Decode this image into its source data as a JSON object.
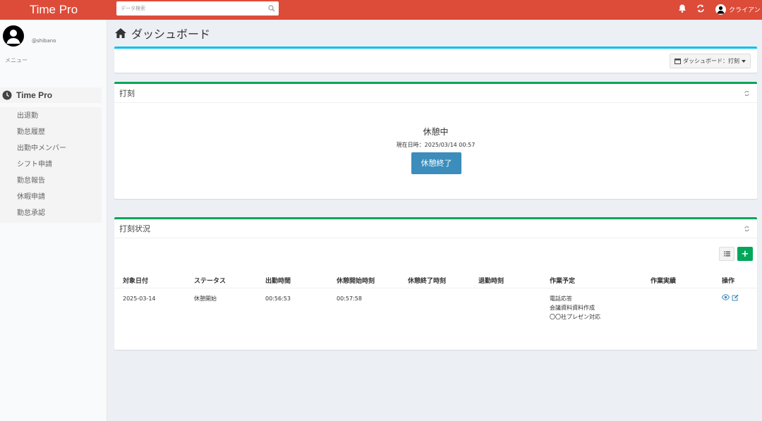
{
  "header": {
    "brand": "Time Pro",
    "search_placeholder": "データ検索",
    "user_label": "クライアント",
    "icons": [
      "search-icon",
      "bell-icon",
      "refresh-icon",
      "user-icon"
    ],
    "color": "#dd4b39"
  },
  "sidebar": {
    "username": "@shibano",
    "menu_label": "メニュー",
    "section_title": "Time Pro",
    "items": [
      "出退勤",
      "勤怠履歴",
      "出勤中メンバー",
      "シフト申請",
      "勤怠報告",
      "休暇申請",
      "勤怠承認"
    ]
  },
  "page": {
    "title": "ダッシュボード",
    "dashboard_select": "ダッシュボード：打刻"
  },
  "punch": {
    "title": "打刻",
    "status": "休憩中",
    "datetime": "現在日時：2025/03/14 00:57",
    "button": "休憩終了",
    "button_color": "#3c8dbc"
  },
  "status_panel": {
    "title": "打刻状況",
    "add_label": "+",
    "columns": [
      "対象日付",
      "ステータス",
      "出勤時間",
      "休憩開始時刻",
      "休憩終了時刻",
      "退勤時刻",
      "作業予定",
      "作業実績",
      "操作"
    ],
    "rows": [
      {
        "date": "2025-03-14",
        "status": "休憩開始",
        "clock_in": "00:56:53",
        "break_start": "00:57:58",
        "break_end": "",
        "clock_out": "",
        "plan": [
          "電話応答",
          "会議資料資料作成",
          "〇〇社プレゼン対応"
        ],
        "actual": ""
      }
    ]
  }
}
